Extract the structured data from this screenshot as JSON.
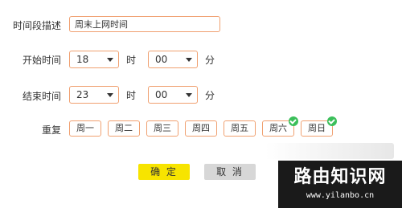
{
  "form": {
    "desc_label": "时间段描述",
    "desc_value": "周末上网时间",
    "start_label": "开始时间",
    "start_hour": "18",
    "start_min": "00",
    "end_label": "结束时间",
    "end_hour": "23",
    "end_min": "00",
    "hour_unit": "时",
    "min_unit": "分",
    "repeat_label": "重复",
    "days": [
      {
        "label": "周一",
        "checked": false
      },
      {
        "label": "周二",
        "checked": false
      },
      {
        "label": "周三",
        "checked": false
      },
      {
        "label": "周四",
        "checked": false
      },
      {
        "label": "周五",
        "checked": false
      },
      {
        "label": "周六",
        "checked": true
      },
      {
        "label": "周日",
        "checked": true
      }
    ]
  },
  "buttons": {
    "ok": "确 定",
    "cancel": "取 消"
  },
  "watermark": {
    "title": "路由知识网",
    "url": "www.yilanbo.cn"
  },
  "colors": {
    "accent_border": "#f0a070",
    "ok_button": "#f7e400",
    "cancel_button": "#d7d7d7",
    "check_badge": "#3bbf5a"
  }
}
